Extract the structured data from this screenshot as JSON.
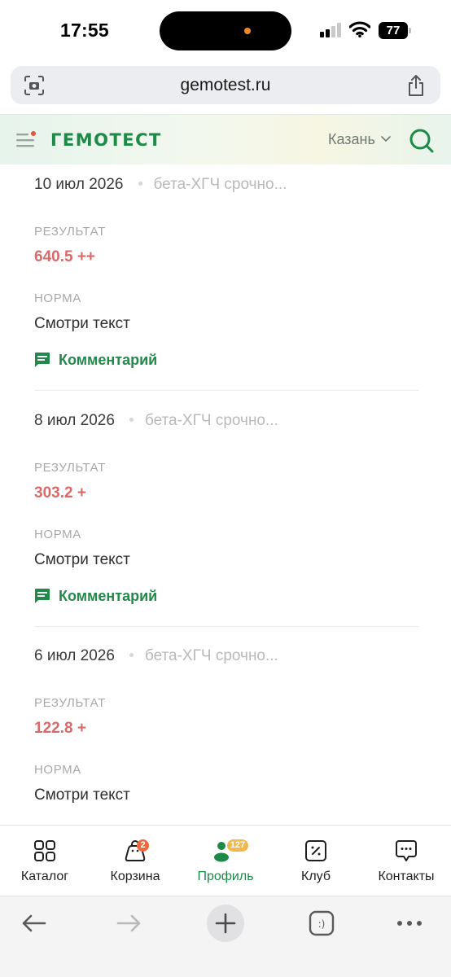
{
  "status_bar": {
    "time": "17:55",
    "battery": "77"
  },
  "browser": {
    "url": "gemotest.ru"
  },
  "header": {
    "logo": "ГЕМОТЕСТ",
    "city": "Казань"
  },
  "results": [
    {
      "date": "10 июл 2026",
      "test": "бета-ХГЧ срочно...",
      "result_label": "РЕЗУЛЬТАТ",
      "result_value": "640.5 ++",
      "norm_label": "НОРМА",
      "norm_value": "Смотри текст",
      "comment": "Комментарий"
    },
    {
      "date": "8 июл 2026",
      "test": "бета-ХГЧ срочно...",
      "result_label": "РЕЗУЛЬТАТ",
      "result_value": "303.2 +",
      "norm_label": "НОРМА",
      "norm_value": "Смотри текст",
      "comment": "Комментарий"
    },
    {
      "date": "6 июл 2026",
      "test": "бета-ХГЧ срочно...",
      "result_label": "РЕЗУЛЬТАТ",
      "result_value": "122.8 +",
      "norm_label": "НОРМА",
      "norm_value": "Смотри текст"
    }
  ],
  "tabs": [
    {
      "label": "Каталог",
      "icon": "grid-icon"
    },
    {
      "label": "Корзина",
      "icon": "bag-icon",
      "badge": "2"
    },
    {
      "label": "Профиль",
      "icon": "profile-icon",
      "badge": "127",
      "active": true
    },
    {
      "label": "Клуб",
      "icon": "discount-icon"
    },
    {
      "label": "Контакты",
      "icon": "chat-icon"
    }
  ],
  "colors": {
    "brand_green": "#1e8a48",
    "result_red": "#d86a6a",
    "badge_orange": "#ee6a3c",
    "badge_gold": "#f2b84b"
  }
}
